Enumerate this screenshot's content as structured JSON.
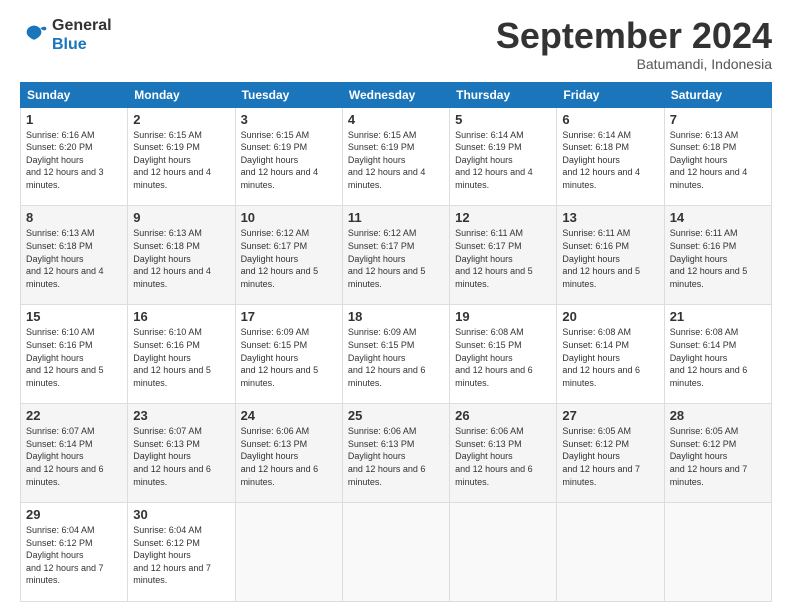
{
  "logo": {
    "line1": "General",
    "line2": "Blue"
  },
  "title": "September 2024",
  "location": "Batumandi, Indonesia",
  "days_of_week": [
    "Sunday",
    "Monday",
    "Tuesday",
    "Wednesday",
    "Thursday",
    "Friday",
    "Saturday"
  ],
  "weeks": [
    [
      {
        "day": "1",
        "sunrise": "6:16 AM",
        "sunset": "6:20 PM",
        "daylight": "12 hours and 3 minutes."
      },
      {
        "day": "2",
        "sunrise": "6:15 AM",
        "sunset": "6:19 PM",
        "daylight": "12 hours and 4 minutes."
      },
      {
        "day": "3",
        "sunrise": "6:15 AM",
        "sunset": "6:19 PM",
        "daylight": "12 hours and 4 minutes."
      },
      {
        "day": "4",
        "sunrise": "6:15 AM",
        "sunset": "6:19 PM",
        "daylight": "12 hours and 4 minutes."
      },
      {
        "day": "5",
        "sunrise": "6:14 AM",
        "sunset": "6:19 PM",
        "daylight": "12 hours and 4 minutes."
      },
      {
        "day": "6",
        "sunrise": "6:14 AM",
        "sunset": "6:18 PM",
        "daylight": "12 hours and 4 minutes."
      },
      {
        "day": "7",
        "sunrise": "6:13 AM",
        "sunset": "6:18 PM",
        "daylight": "12 hours and 4 minutes."
      }
    ],
    [
      {
        "day": "8",
        "sunrise": "6:13 AM",
        "sunset": "6:18 PM",
        "daylight": "12 hours and 4 minutes."
      },
      {
        "day": "9",
        "sunrise": "6:13 AM",
        "sunset": "6:18 PM",
        "daylight": "12 hours and 4 minutes."
      },
      {
        "day": "10",
        "sunrise": "6:12 AM",
        "sunset": "6:17 PM",
        "daylight": "12 hours and 5 minutes."
      },
      {
        "day": "11",
        "sunrise": "6:12 AM",
        "sunset": "6:17 PM",
        "daylight": "12 hours and 5 minutes."
      },
      {
        "day": "12",
        "sunrise": "6:11 AM",
        "sunset": "6:17 PM",
        "daylight": "12 hours and 5 minutes."
      },
      {
        "day": "13",
        "sunrise": "6:11 AM",
        "sunset": "6:16 PM",
        "daylight": "12 hours and 5 minutes."
      },
      {
        "day": "14",
        "sunrise": "6:11 AM",
        "sunset": "6:16 PM",
        "daylight": "12 hours and 5 minutes."
      }
    ],
    [
      {
        "day": "15",
        "sunrise": "6:10 AM",
        "sunset": "6:16 PM",
        "daylight": "12 hours and 5 minutes."
      },
      {
        "day": "16",
        "sunrise": "6:10 AM",
        "sunset": "6:16 PM",
        "daylight": "12 hours and 5 minutes."
      },
      {
        "day": "17",
        "sunrise": "6:09 AM",
        "sunset": "6:15 PM",
        "daylight": "12 hours and 5 minutes."
      },
      {
        "day": "18",
        "sunrise": "6:09 AM",
        "sunset": "6:15 PM",
        "daylight": "12 hours and 6 minutes."
      },
      {
        "day": "19",
        "sunrise": "6:08 AM",
        "sunset": "6:15 PM",
        "daylight": "12 hours and 6 minutes."
      },
      {
        "day": "20",
        "sunrise": "6:08 AM",
        "sunset": "6:14 PM",
        "daylight": "12 hours and 6 minutes."
      },
      {
        "day": "21",
        "sunrise": "6:08 AM",
        "sunset": "6:14 PM",
        "daylight": "12 hours and 6 minutes."
      }
    ],
    [
      {
        "day": "22",
        "sunrise": "6:07 AM",
        "sunset": "6:14 PM",
        "daylight": "12 hours and 6 minutes."
      },
      {
        "day": "23",
        "sunrise": "6:07 AM",
        "sunset": "6:13 PM",
        "daylight": "12 hours and 6 minutes."
      },
      {
        "day": "24",
        "sunrise": "6:06 AM",
        "sunset": "6:13 PM",
        "daylight": "12 hours and 6 minutes."
      },
      {
        "day": "25",
        "sunrise": "6:06 AM",
        "sunset": "6:13 PM",
        "daylight": "12 hours and 6 minutes."
      },
      {
        "day": "26",
        "sunrise": "6:06 AM",
        "sunset": "6:13 PM",
        "daylight": "12 hours and 6 minutes."
      },
      {
        "day": "27",
        "sunrise": "6:05 AM",
        "sunset": "6:12 PM",
        "daylight": "12 hours and 7 minutes."
      },
      {
        "day": "28",
        "sunrise": "6:05 AM",
        "sunset": "6:12 PM",
        "daylight": "12 hours and 7 minutes."
      }
    ],
    [
      {
        "day": "29",
        "sunrise": "6:04 AM",
        "sunset": "6:12 PM",
        "daylight": "12 hours and 7 minutes."
      },
      {
        "day": "30",
        "sunrise": "6:04 AM",
        "sunset": "6:12 PM",
        "daylight": "12 hours and 7 minutes."
      },
      null,
      null,
      null,
      null,
      null
    ]
  ]
}
